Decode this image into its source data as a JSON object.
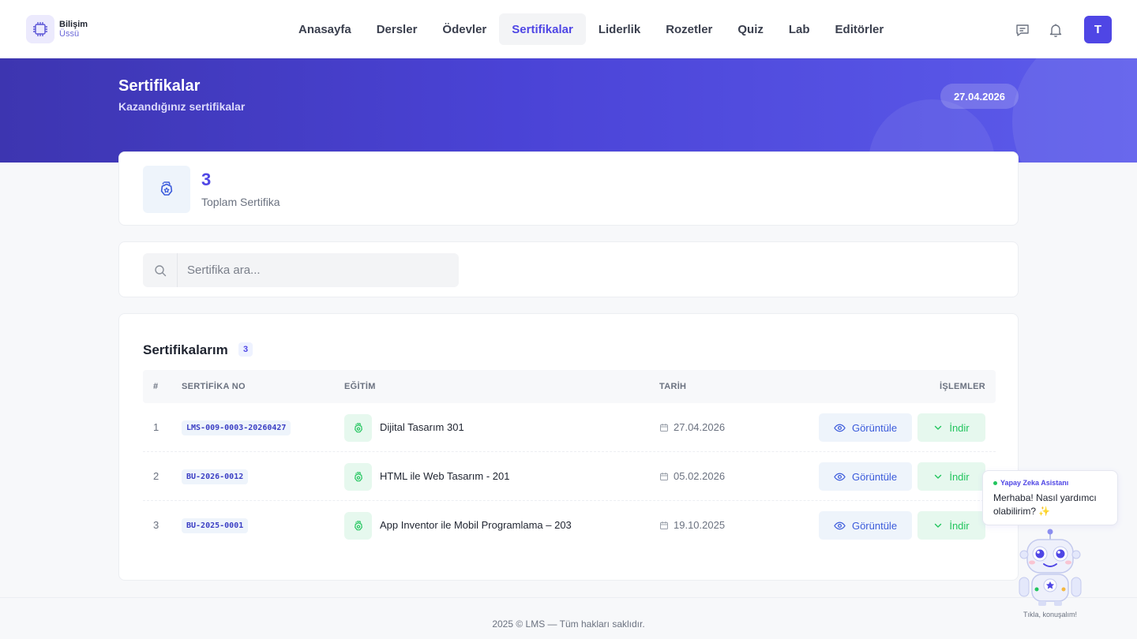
{
  "brand": {
    "line1": "Bilişim",
    "line2": "Üssü"
  },
  "nav": {
    "items": [
      {
        "label": "Anasayfa"
      },
      {
        "label": "Dersler"
      },
      {
        "label": "Ödevler"
      },
      {
        "label": "Sertifikalar",
        "active": true
      },
      {
        "label": "Liderlik"
      },
      {
        "label": "Rozetler"
      },
      {
        "label": "Quiz"
      },
      {
        "label": "Lab"
      },
      {
        "label": "Editörler"
      }
    ]
  },
  "user": {
    "initial": "T"
  },
  "hero": {
    "title": "Sertifikalar",
    "subtitle": "Kazandığınız sertifikalar",
    "date": "27.04.2026"
  },
  "stats": {
    "count": "3",
    "label": "Toplam Sertifika"
  },
  "search": {
    "placeholder": "Sertifika ara..."
  },
  "list": {
    "title": "Sertifikalarım",
    "count": "3",
    "columns": {
      "index": "#",
      "cert_no": "SERTİFİKA NO",
      "education": "EĞİTİM",
      "date": "TARİH",
      "actions": "İŞLEMLER"
    },
    "view_label": "Görüntüle",
    "download_label": "İndir",
    "rows": [
      {
        "index": "1",
        "cert_no": "LMS-009-0003-20260427",
        "education": "Dijital Tasarım 301",
        "date": "27.04.2026"
      },
      {
        "index": "2",
        "cert_no": "BU-2026-0012",
        "education": "HTML ile Web Tasarım - 201",
        "date": "05.02.2026"
      },
      {
        "index": "3",
        "cert_no": "BU-2025-0001",
        "education": "App Inventor ile Mobil Programlama – 203",
        "date": "19.10.2025"
      }
    ]
  },
  "footer": {
    "text": "2025 © LMS — Tüm hakları saklıdır."
  },
  "assistant": {
    "title": "Yapay Zeka Asistanı",
    "message": "Merhaba! Nasıl yardımcı olabilirim? ✨",
    "caption": "Tıkla, konuşalım!"
  },
  "colors": {
    "accent": "#4f46e5",
    "success": "#22c55e",
    "hero_start": "#3d35b0",
    "hero_end": "#5d5cec"
  }
}
